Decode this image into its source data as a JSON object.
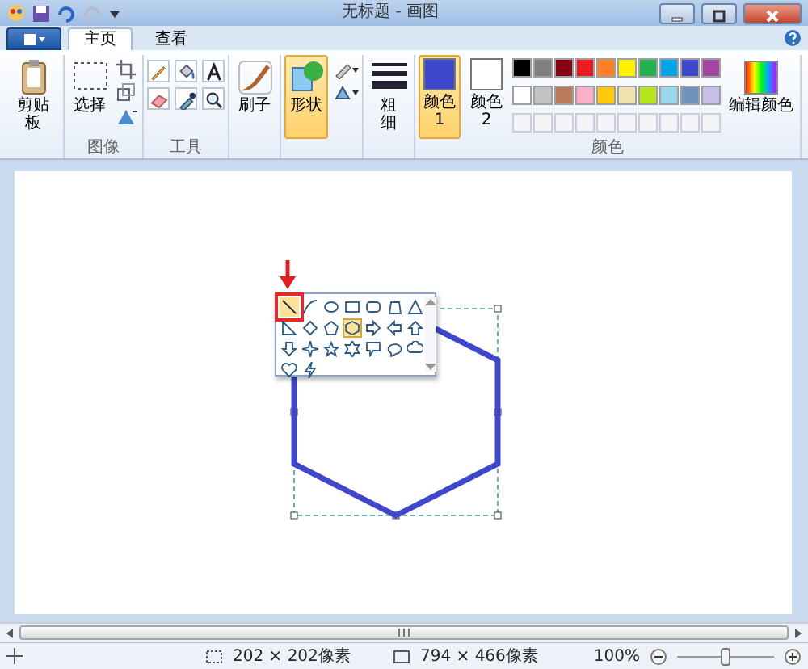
{
  "window": {
    "title": "无标题 - 画图"
  },
  "tabs": [
    {
      "label": "主页",
      "selected": true
    },
    {
      "label": "查看",
      "selected": false
    }
  ],
  "ribbon": {
    "clipboard_button": "剪贴板",
    "select_button": "选择",
    "image_group": "图像",
    "tools_group": "工具",
    "brushes_button": "刷子",
    "shapes_button": {
      "label": "形状",
      "selected": true
    },
    "size_button": "粗细",
    "color1": {
      "label": "颜色 1",
      "color": "#3f48cc",
      "selected": true
    },
    "color2": {
      "label": "颜色 2",
      "color": "#ffffff",
      "selected": false
    },
    "palette": [
      {
        "color": "#000000"
      },
      {
        "color": "#7f7f7f"
      },
      {
        "color": "#880015"
      },
      {
        "color": "#ed1c24"
      },
      {
        "color": "#ff7f27"
      },
      {
        "color": "#fff200"
      },
      {
        "color": "#22b14c"
      },
      {
        "color": "#00a2e8"
      },
      {
        "color": "#3f48cc"
      },
      {
        "color": "#a349a4"
      },
      {
        "color": "#ffffff"
      },
      {
        "color": "#c3c3c3"
      },
      {
        "color": "#b97a57"
      },
      {
        "color": "#ffaec9"
      },
      {
        "color": "#ffc90e"
      },
      {
        "color": "#efe4b0"
      },
      {
        "color": "#b5e61d"
      },
      {
        "color": "#99d9ea"
      },
      {
        "color": "#7092be"
      },
      {
        "color": "#c8bfe7"
      }
    ],
    "colors_group": "颜色",
    "edit_colors_button": "编辑颜色"
  },
  "shapes_gallery": [
    {
      "kind": "line",
      "selected": false,
      "hovered": true
    },
    {
      "kind": "curve",
      "selected": false,
      "hovered": false
    },
    {
      "kind": "oval",
      "selected": false,
      "hovered": false
    },
    {
      "kind": "rectangle",
      "selected": false,
      "hovered": false
    },
    {
      "kind": "rounded-rectangle",
      "selected": false,
      "hovered": false
    },
    {
      "kind": "polygon",
      "selected": false,
      "hovered": false
    },
    {
      "kind": "triangle",
      "selected": false,
      "hovered": false
    },
    {
      "kind": "right-triangle",
      "selected": false,
      "hovered": false
    },
    {
      "kind": "diamond",
      "selected": false,
      "hovered": false
    },
    {
      "kind": "pentagon",
      "selected": false,
      "hovered": false
    },
    {
      "kind": "hexagon",
      "selected": true,
      "hovered": false
    },
    {
      "kind": "right-arrow",
      "selected": false,
      "hovered": false
    },
    {
      "kind": "left-arrow",
      "selected": false,
      "hovered": false
    },
    {
      "kind": "up-arrow",
      "selected": false,
      "hovered": false
    },
    {
      "kind": "down-arrow",
      "selected": false,
      "hovered": false
    },
    {
      "kind": "star4",
      "selected": false,
      "hovered": false
    },
    {
      "kind": "star5",
      "selected": false,
      "hovered": false
    },
    {
      "kind": "star6",
      "selected": false,
      "hovered": false
    },
    {
      "kind": "rect-callout",
      "selected": false,
      "hovered": false
    },
    {
      "kind": "oval-callout",
      "selected": false,
      "hovered": false
    },
    {
      "kind": "cloud-callout",
      "selected": false,
      "hovered": false
    },
    {
      "kind": "heart",
      "selected": false,
      "hovered": false
    },
    {
      "kind": "lightning",
      "selected": false,
      "hovered": false
    }
  ],
  "status_bar": {
    "selection_size": "202 × 202像素",
    "canvas_size": "794 × 466像素",
    "zoom": "100%",
    "zoom_slider": {
      "level": 0.5
    }
  }
}
